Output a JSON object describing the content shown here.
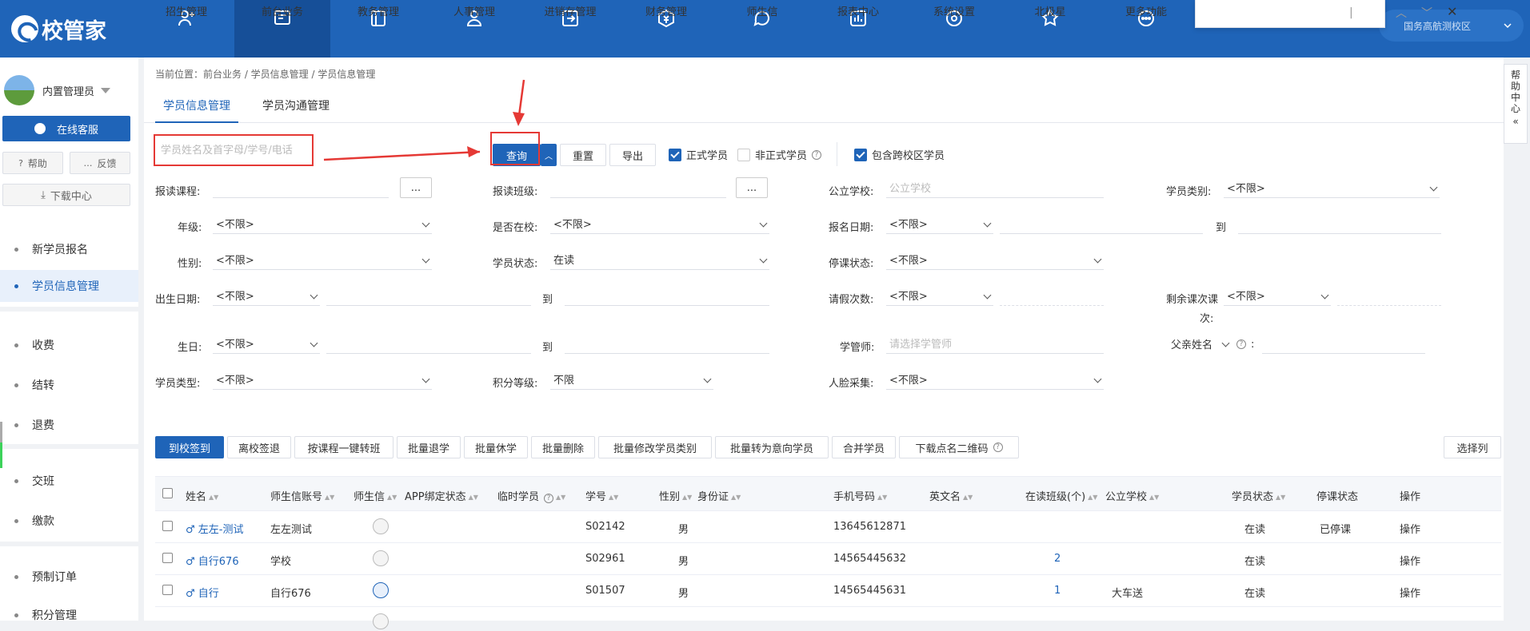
{
  "header": {
    "logo_text": "校管家",
    "nav": [
      {
        "label": "招生管理",
        "icon": "user-add-icon"
      },
      {
        "label": "前台业务",
        "icon": "monitor-icon",
        "active": true
      },
      {
        "label": "教务管理",
        "icon": "book-icon"
      },
      {
        "label": "人事管理",
        "icon": "person-icon"
      },
      {
        "label": "进销存管理",
        "icon": "inventory-icon"
      },
      {
        "label": "财务管理",
        "icon": "finance-icon"
      },
      {
        "label": "师生信",
        "icon": "message-icon"
      },
      {
        "label": "报表中心",
        "icon": "report-icon"
      },
      {
        "label": "系统设置",
        "icon": "settings-icon"
      },
      {
        "label": "北极星",
        "icon": "star-icon"
      },
      {
        "label": "更多功能",
        "icon": "more-icon"
      }
    ],
    "campus_select": "国务高航测校区"
  },
  "sidebar": {
    "username": "内置管理员",
    "online_service": "在线客服",
    "help": "帮助",
    "feedback": "反馈",
    "download_center": "下载中心",
    "items": [
      "新学员报名",
      "学员信息管理",
      "收费",
      "结转",
      "退费",
      "交班",
      "缴款",
      "预制订单",
      "积分管理"
    ]
  },
  "breadcrumb": "当前位置：前台业务 / 学员信息管理 / 学员信息管理",
  "tabs": [
    "学员信息管理",
    "学员沟通管理"
  ],
  "search": {
    "placeholder": "学员姓名及首字母/学号/电话",
    "query_btn": "查询",
    "reset_btn": "重置",
    "export_btn": "导出",
    "formal_student": "正式学员",
    "informal_student": "非正式学员",
    "cross_campus": "包含跨校区学员"
  },
  "filters": {
    "course_label": "报读课程:",
    "class_label": "报读班级:",
    "school_label": "公立学校:",
    "school_ph": "公立学校",
    "category_label": "学员类别:",
    "grade_label": "年级:",
    "in_school_label": "是否在校:",
    "enroll_date_label": "报名日期:",
    "gender_label": "性别:",
    "status_label": "学员状态:",
    "status_value": "在读",
    "suspend_label": "停课状态:",
    "birth_date_label": "出生日期:",
    "leave_count_label": "请假次数:",
    "remaining_label_1": "剩余课次课",
    "remaining_label_2": "次:",
    "birthday_label": "生日:",
    "manager_label": "学管师:",
    "manager_ph": "请选择学管师",
    "father_select": "父亲姓名",
    "colon": ":",
    "type_label": "学员类型:",
    "points_label": "积分等级:",
    "points_value": "不限",
    "face_label": "人脸采集:",
    "unlimited": "<不限>",
    "to": "到",
    "dots": "..."
  },
  "actions": [
    "到校签到",
    "离校签退",
    "按课程一键转班",
    "批量退学",
    "批量休学",
    "批量删除",
    "批量修改学员类别",
    "批量转为意向学员",
    "合并学员",
    "下载点名二维码"
  ],
  "select_columns": "选择列",
  "help_side": "帮助中心",
  "table": {
    "headers": [
      "姓名",
      "师生信账号",
      "师生信",
      "APP绑定状态",
      "临时学员",
      "学号",
      "性别",
      "身份证",
      "手机号码",
      "英文名",
      "在读班级(个)",
      "公立学校",
      "学员状态",
      "停课状态",
      "操作"
    ],
    "rows": [
      {
        "name": "♂ 左左-测试",
        "account": "左左测试",
        "id": "S02142",
        "gender": "男",
        "phone": "13645612871",
        "classes": "",
        "school": "",
        "status": "在读",
        "suspend": "已停课",
        "op": "操作"
      },
      {
        "name": "♂ 自行676",
        "account": "学校",
        "id": "S02961",
        "gender": "男",
        "phone": "14565445632",
        "classes": "2",
        "school": "",
        "status": "在读",
        "suspend": "",
        "op": "操作"
      },
      {
        "name": "♂ 自行",
        "account": "自行676",
        "id": "S01507",
        "gender": "男",
        "phone": "14565445631",
        "classes": "1",
        "school": "大车送",
        "status": "在读",
        "suspend": "",
        "op": "操作"
      }
    ]
  },
  "colors": {
    "primary": "#1f64b8",
    "annotation": "#e53935"
  }
}
